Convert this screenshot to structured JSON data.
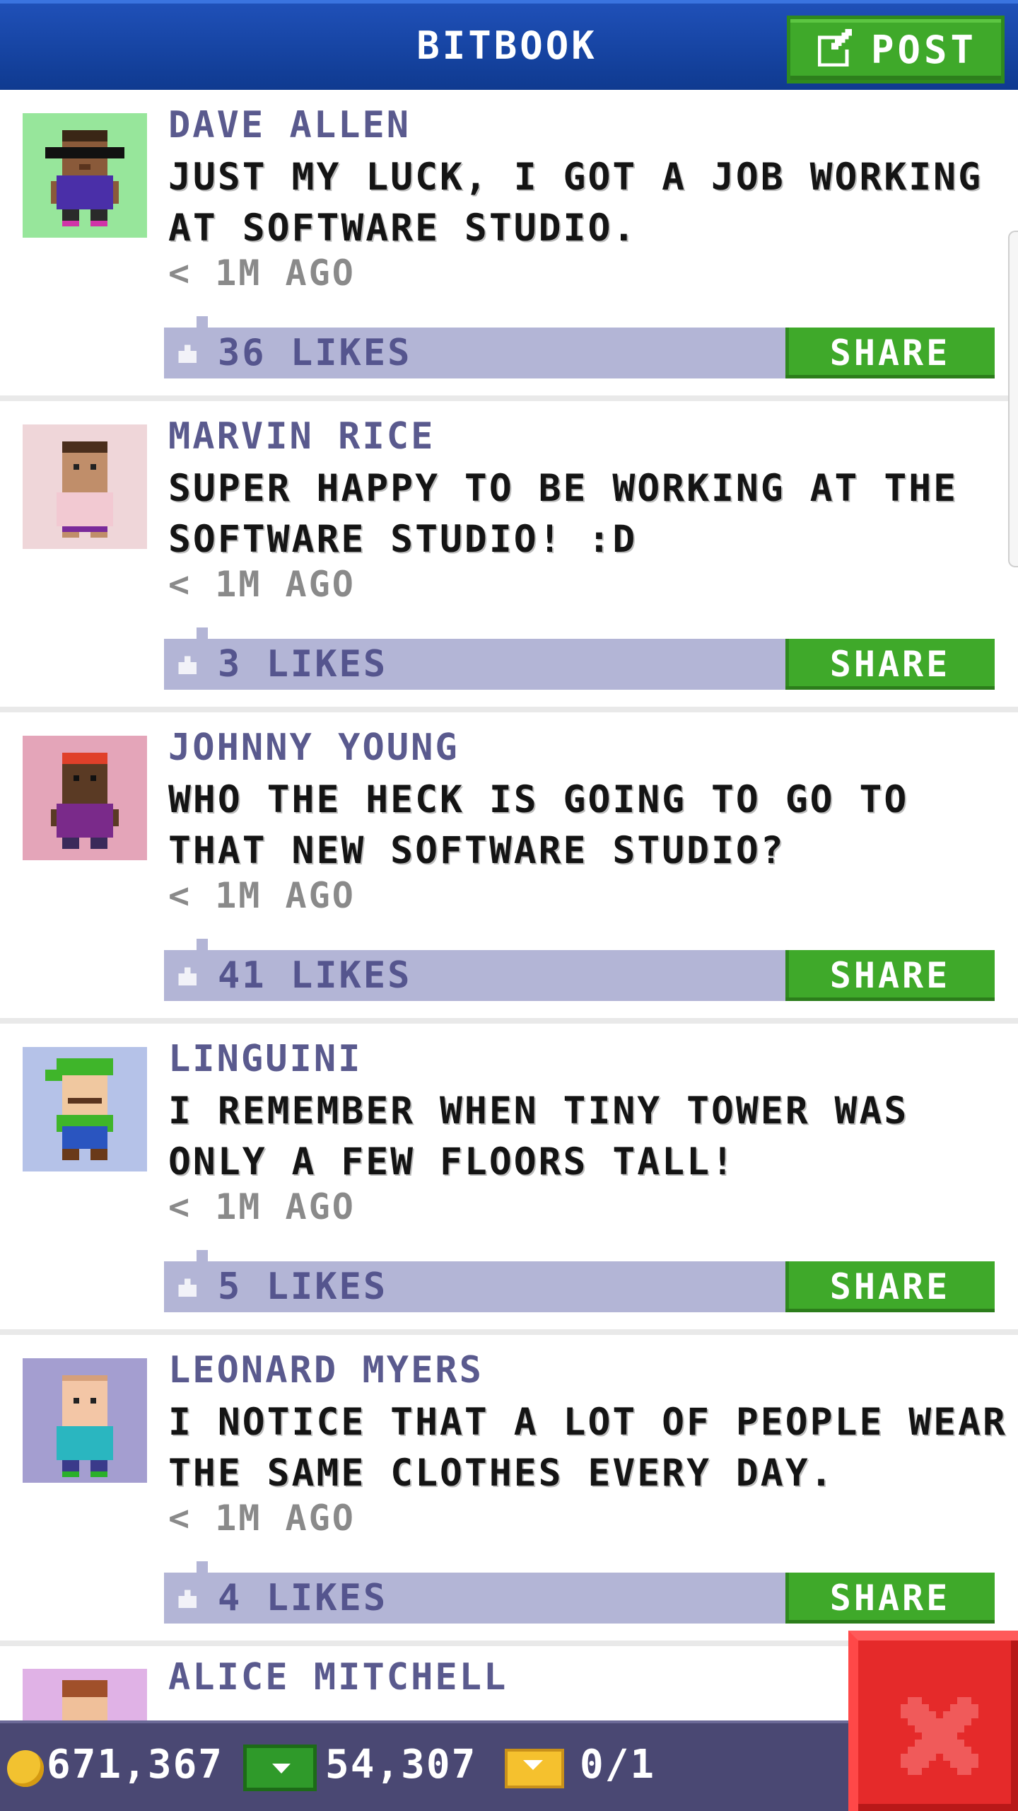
{
  "header": {
    "title": "BITBOOK",
    "post_label": "POST",
    "post_icon": "compose-icon"
  },
  "posts": [
    {
      "author": "DAVE ALLEN",
      "message": "JUST MY LUCK, I GOT A JOB WORKING AT SOFTWARE STUDIO.",
      "time": "< 1M AGO",
      "likes": "36 LIKES",
      "share": "SHARE",
      "avatar_bg": "#97e69b"
    },
    {
      "author": "MARVIN RICE",
      "message": "SUPER HAPPY TO BE WORKING AT THE SOFTWARE STUDIO! :D",
      "time": "< 1M AGO",
      "likes": "3 LIKES",
      "share": "SHARE",
      "avatar_bg": "#efd6d9"
    },
    {
      "author": "JOHNNY YOUNG",
      "message": "WHO THE HECK IS GOING TO GO TO THAT NEW SOFTWARE STUDIO?",
      "time": "< 1M AGO",
      "likes": "41 LIKES",
      "share": "SHARE",
      "avatar_bg": "#e4a5b9"
    },
    {
      "author": "LINGUINI",
      "message": "I REMEMBER WHEN TINY TOWER WAS ONLY A FEW FLOORS TALL!",
      "time": "< 1M AGO",
      "likes": "5 LIKES",
      "share": "SHARE",
      "avatar_bg": "#b5c2e8"
    },
    {
      "author": "LEONARD MYERS",
      "message": "I NOTICE THAT A LOT OF PEOPLE WEAR THE SAME CLOTHES EVERY DAY.",
      "time": "< 1M AGO",
      "likes": "4 LIKES",
      "share": "SHARE",
      "avatar_bg": "#a49ed0"
    },
    {
      "author": "ALICE MITCHELL",
      "avatar_bg": "#e0b2e6"
    }
  ],
  "status_bar": {
    "coins": "671,367",
    "bux": "54,307",
    "tickets": "0/1"
  },
  "colors": {
    "header_bg": "#1a4aa8",
    "accent_green": "#3fa92a",
    "likes_bar": "#b3b5d6",
    "author_text": "#5a5a8e",
    "status_bar_bg": "#4a4873",
    "close_red": "#e52a2a"
  }
}
